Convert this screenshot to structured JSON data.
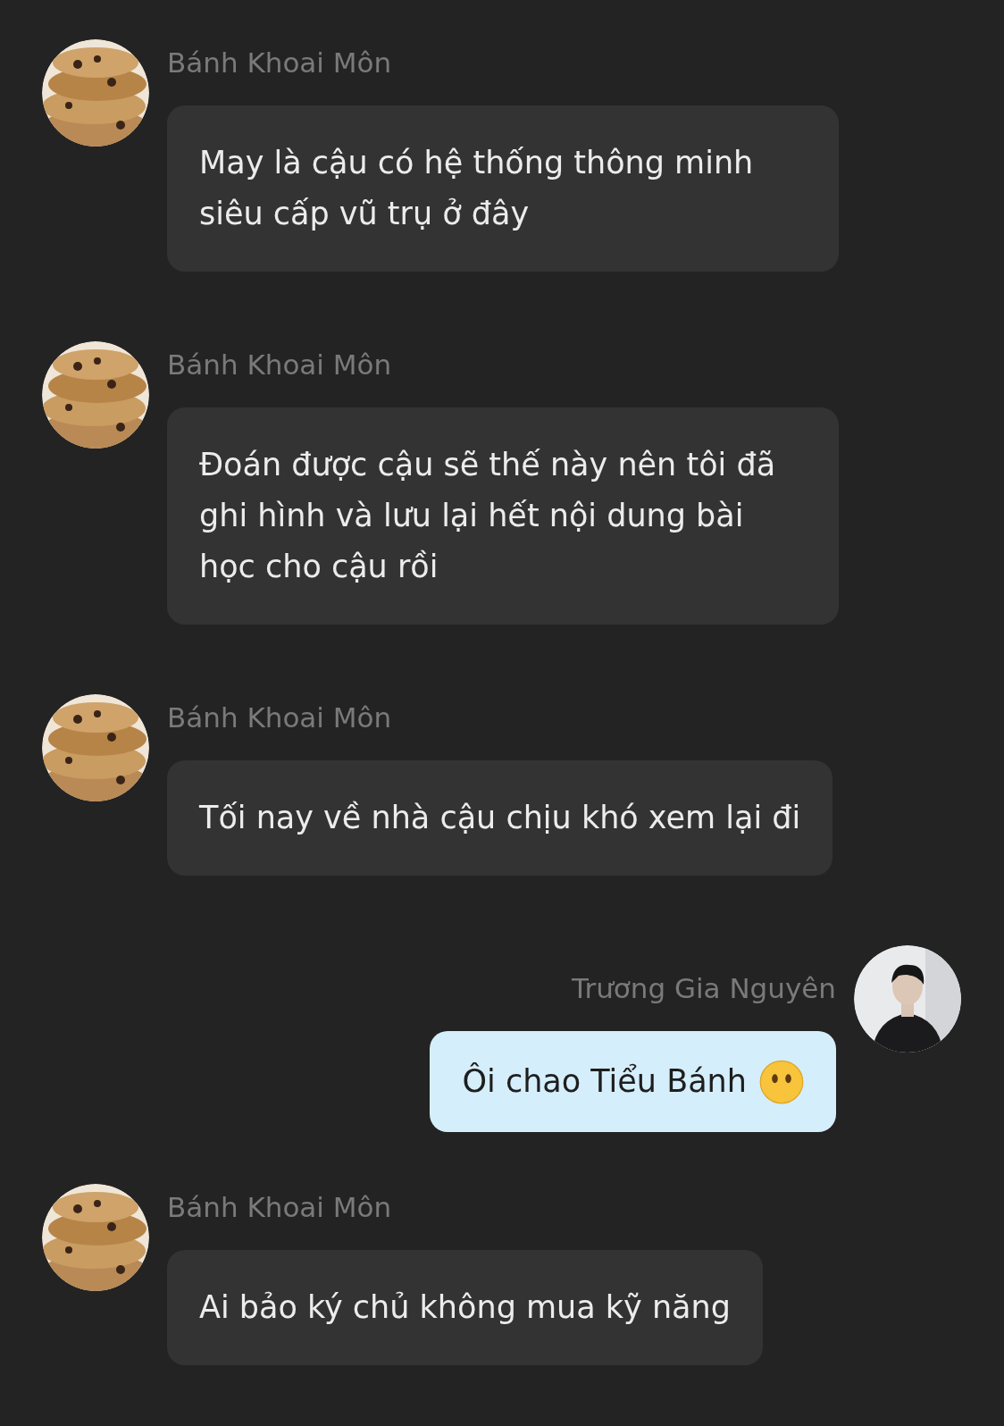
{
  "messages": [
    {
      "kind": "incoming",
      "sender": "Bánh Khoai Môn",
      "text": "May là cậu có hệ thống thông minh siêu cấp vũ trụ ở đây",
      "emoji": false
    },
    {
      "kind": "incoming",
      "sender": "Bánh Khoai Môn",
      "text": "Đoán được cậu sẽ thế này nên tôi đã ghi hình và lưu lại hết nội dung bài học cho cậu rồi",
      "emoji": false
    },
    {
      "kind": "incoming",
      "sender": "Bánh Khoai Môn",
      "text": "Tối nay về nhà cậu chịu khó xem lại đi",
      "emoji": false
    },
    {
      "kind": "outgoing",
      "sender": "Trương Gia Nguyên",
      "text": "Ôi chao Tiểu Bánh",
      "emoji": true
    },
    {
      "kind": "incoming",
      "sender": "Bánh Khoai Môn",
      "text": "Ai bảo ký chủ không mua kỹ năng",
      "emoji": false
    }
  ]
}
